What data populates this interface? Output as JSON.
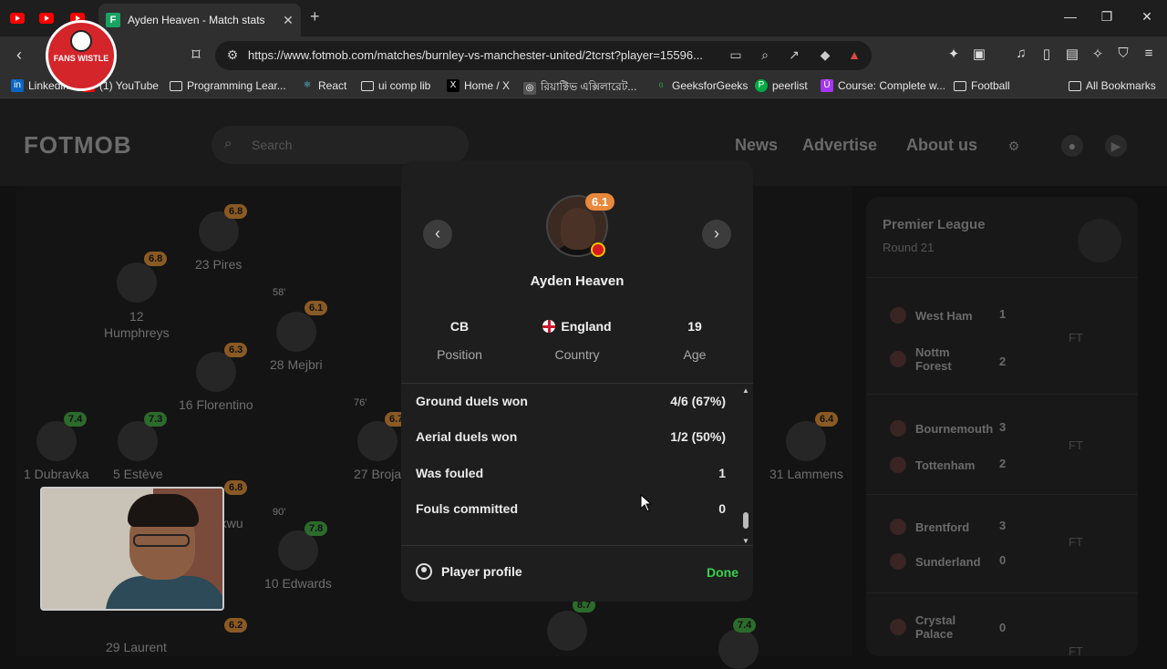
{
  "browser": {
    "active_tab_title": "Ayden Heaven - Match stats",
    "url": "https://www.fotmob.com/matches/burnley-vs-manchester-united/2tcrst?player=15596...",
    "bookmarks": [
      "Linkedin",
      "(1) YouTube",
      "Programming Lear...",
      "React",
      "ui comp lib",
      "Home / X",
      "রিয়াক্টিভ এক্সিলারেট...",
      "GeeksforGeeks",
      "peerlist",
      "Course: Complete w...",
      "Football",
      "All Bookmarks"
    ]
  },
  "overlay_logo": {
    "text": "FANS WISTLE"
  },
  "header": {
    "logo": "FOTMOB",
    "search_placeholder": "Search",
    "nav": [
      "News",
      "Advertise",
      "About us"
    ]
  },
  "pitch": {
    "players": [
      {
        "name": "23 Pires",
        "rating": "6.8"
      },
      {
        "name": "12\nHumphreys",
        "rating": "6.8"
      },
      {
        "name": "28 Mejbri",
        "rating": "6.1",
        "minute": "58'"
      },
      {
        "name": "16 Florentino",
        "rating": "6.3"
      },
      {
        "name": "1 Dubravka",
        "rating": "7.4"
      },
      {
        "name": "5 Estève",
        "rating": "7.3"
      },
      {
        "name": "27 Broja",
        "rating": "6.7",
        "minute": "76'"
      },
      {
        "name": "10 Edwards",
        "rating": "7.8",
        "minute": "90'"
      },
      {
        "name": "ukwu",
        "rating": "6.8"
      },
      {
        "name": "29 Laurent",
        "rating": "6.2"
      },
      {
        "name": "31 Lammens",
        "rating": "6.4"
      },
      {
        "name": "",
        "rating": "8.7"
      },
      {
        "name": "",
        "rating": "7.4"
      }
    ]
  },
  "sidebar": {
    "league": "Premier League",
    "round": "Round 21",
    "matches": [
      {
        "home": "West Ham",
        "home_score": "1",
        "away": "Nottm\nForest",
        "away_score": "2",
        "status": "FT"
      },
      {
        "home": "Bournemouth",
        "home_score": "3",
        "away": "Tottenham",
        "away_score": "2",
        "status": "FT"
      },
      {
        "home": "Brentford",
        "home_score": "3",
        "away": "Sunderland",
        "away_score": "0",
        "status": "FT"
      },
      {
        "home": "Crystal\nPalace",
        "home_score": "0",
        "away": "",
        "away_score": "",
        "status": "FT"
      }
    ]
  },
  "modal": {
    "player_name": "Ayden Heaven",
    "rating": "6.1",
    "position": {
      "value": "CB",
      "label": "Position"
    },
    "country": {
      "value": "England",
      "label": "Country"
    },
    "age": {
      "value": "19",
      "label": "Age"
    },
    "stats": [
      {
        "label": "Ground duels won",
        "value": "4/6 (67%)"
      },
      {
        "label": "Aerial duels won",
        "value": "1/2 (50%)"
      },
      {
        "label": "Was fouled",
        "value": "1"
      },
      {
        "label": "Fouls committed",
        "value": "0"
      }
    ],
    "profile_label": "Player profile",
    "done_label": "Done"
  },
  "colors": {
    "accent_green": "#3ccf4e",
    "rating_orange": "#e8883a"
  }
}
